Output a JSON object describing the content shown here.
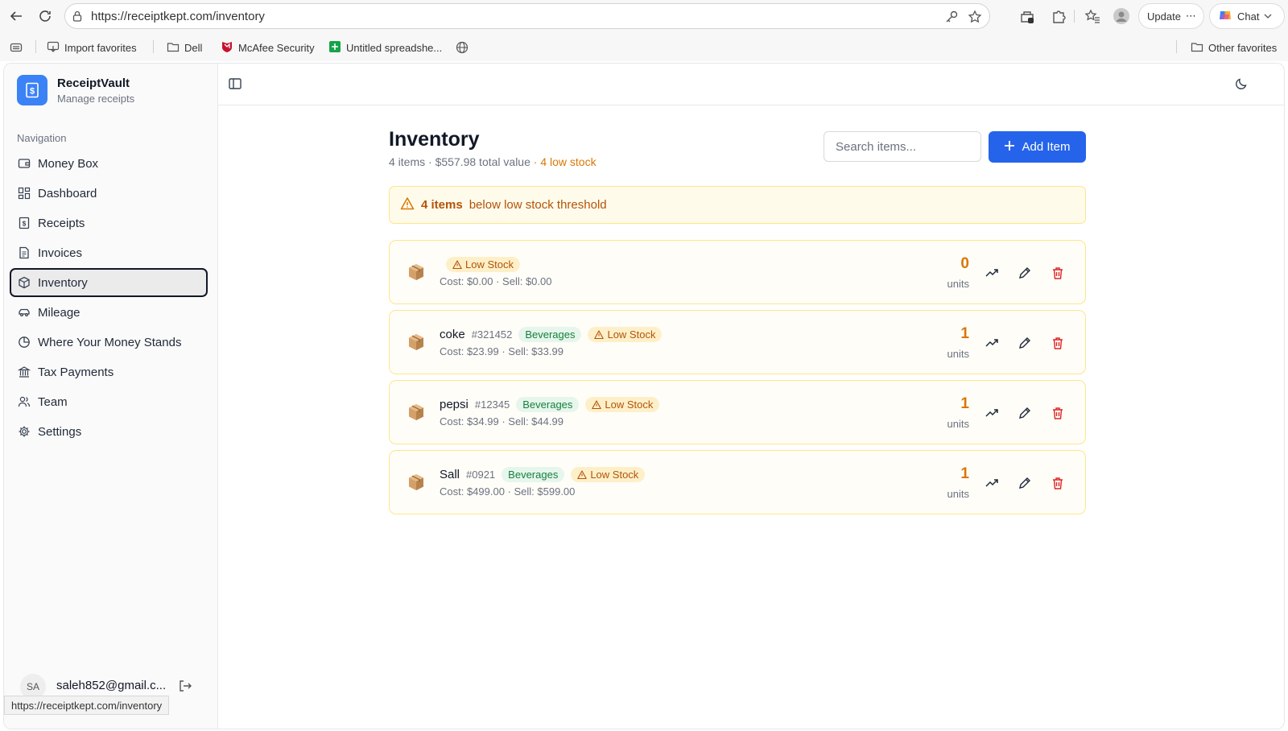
{
  "browser": {
    "url": "https://receiptkept.com/inventory",
    "update_label": "Update",
    "chat_label": "Chat",
    "bookmarks": [
      "Import favorites",
      "Dell",
      "McAfee Security",
      "Untitled spreadshe..."
    ],
    "other_favorites": "Other favorites",
    "status_url": "https://receiptkept.com/inventory"
  },
  "brand": {
    "name": "ReceiptVault",
    "subtitle": "Manage receipts"
  },
  "sidebar": {
    "heading": "Navigation",
    "items": [
      {
        "label": "Money Box",
        "icon": "wallet-icon"
      },
      {
        "label": "Dashboard",
        "icon": "dashboard-icon"
      },
      {
        "label": "Receipts",
        "icon": "receipt-icon"
      },
      {
        "label": "Invoices",
        "icon": "invoice-icon"
      },
      {
        "label": "Inventory",
        "icon": "package-icon",
        "active": true
      },
      {
        "label": "Mileage",
        "icon": "car-icon"
      },
      {
        "label": "Where Your Money Stands",
        "icon": "pie-chart-icon"
      },
      {
        "label": "Tax Payments",
        "icon": "bank-icon"
      },
      {
        "label": "Team",
        "icon": "users-icon"
      },
      {
        "label": "Settings",
        "icon": "gear-icon"
      }
    ],
    "user": {
      "initials": "SA",
      "email": "saleh852@gmail.c..."
    }
  },
  "page": {
    "title": "Inventory",
    "summary": "4 items · $557.98 total value",
    "low_summary": "· 4 low stock",
    "search_placeholder": "Search items...",
    "add_label": "Add Item",
    "alert_count": "4 items",
    "alert_text": "below low stock threshold"
  },
  "items": [
    {
      "name": "",
      "sku": "",
      "category": "",
      "badge": "Low Stock",
      "prices": "Cost: $0.00 · Sell: $0.00",
      "qty": "0",
      "units": "units"
    },
    {
      "name": "coke",
      "sku": "#321452",
      "category": "Beverages",
      "badge": "Low Stock",
      "prices": "Cost: $23.99 · Sell: $33.99",
      "qty": "1",
      "units": "units"
    },
    {
      "name": "pepsi",
      "sku": "#12345",
      "category": "Beverages",
      "badge": "Low Stock",
      "prices": "Cost: $34.99 · Sell: $44.99",
      "qty": "1",
      "units": "units"
    },
    {
      "name": "Sall",
      "sku": "#0921",
      "category": "Beverages",
      "badge": "Low Stock",
      "prices": "Cost: $499.00 · Sell: $599.00",
      "qty": "1",
      "units": "units"
    }
  ],
  "colors": {
    "accent": "#2563eb",
    "warning": "#d97706",
    "success": "#16803c",
    "danger": "#dc2626"
  }
}
